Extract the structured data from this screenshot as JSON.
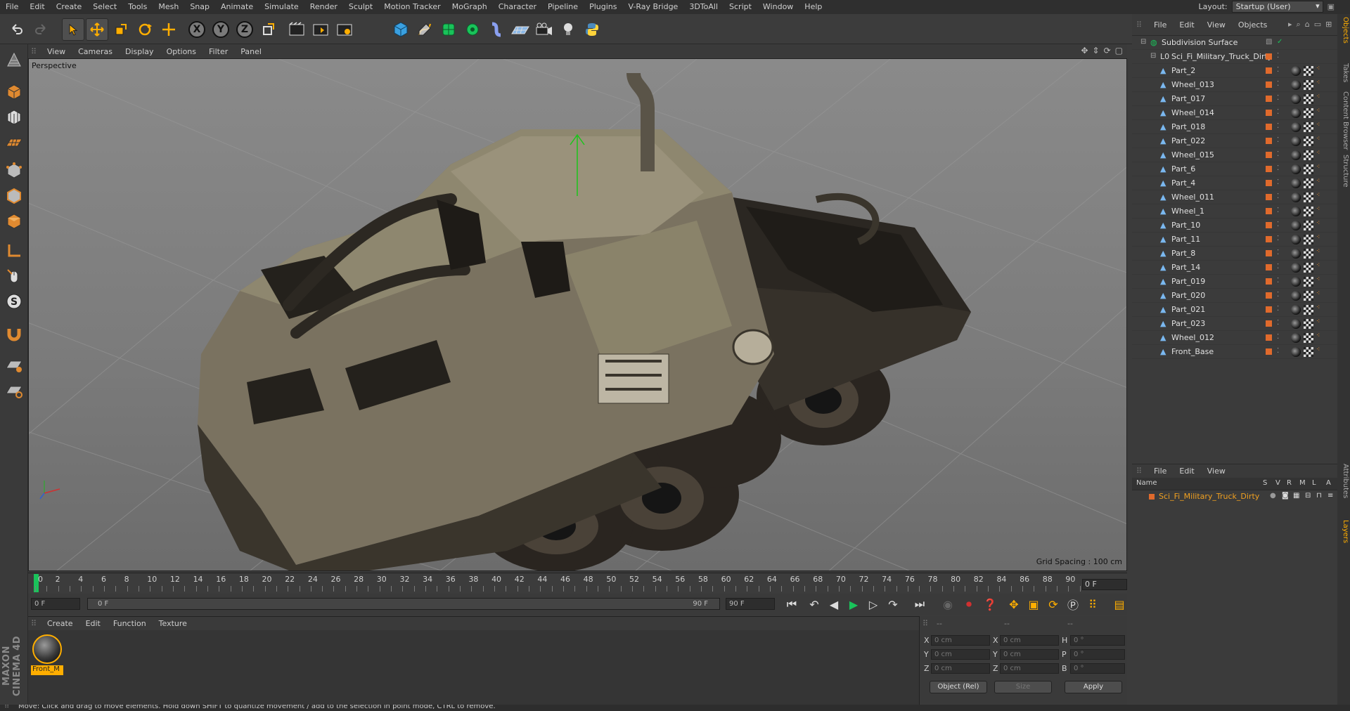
{
  "menu": [
    "File",
    "Edit",
    "Create",
    "Select",
    "Tools",
    "Mesh",
    "Snap",
    "Animate",
    "Simulate",
    "Render",
    "Sculpt",
    "Motion Tracker",
    "MoGraph",
    "Character",
    "Pipeline",
    "Plugins",
    "V-Ray Bridge",
    "3DToAll",
    "Script",
    "Window",
    "Help"
  ],
  "layout": {
    "label": "Layout:",
    "value": "Startup (User)"
  },
  "viewport": {
    "menu": [
      "View",
      "Cameras",
      "Display",
      "Options",
      "Filter",
      "Panel"
    ],
    "label": "Perspective",
    "grid_spacing": "Grid Spacing : 100 cm"
  },
  "timeline": {
    "ticks": [
      "0",
      "2",
      "4",
      "6",
      "8",
      "10",
      "12",
      "14",
      "16",
      "18",
      "20",
      "22",
      "24",
      "26",
      "28",
      "30",
      "32",
      "34",
      "36",
      "38",
      "40",
      "42",
      "44",
      "46",
      "48",
      "50",
      "52",
      "54",
      "56",
      "58",
      "60",
      "62",
      "64",
      "66",
      "68",
      "70",
      "72",
      "74",
      "76",
      "78",
      "80",
      "82",
      "84",
      "86",
      "88",
      "90"
    ],
    "current_frame": "0 F"
  },
  "transport": {
    "start": "0 F",
    "range_start": "0 F",
    "range_end": "90 F",
    "end": "90 F"
  },
  "materials": {
    "menu": [
      "Create",
      "Edit",
      "Function",
      "Texture"
    ],
    "items": [
      {
        "name": "Front_M"
      }
    ]
  },
  "coords": {
    "headers": [
      "--",
      "--",
      "--"
    ],
    "rows": [
      {
        "a": "X",
        "av": "0 cm",
        "b": "X",
        "bv": "0 cm",
        "c": "H",
        "cv": "0 °"
      },
      {
        "a": "Y",
        "av": "0 cm",
        "b": "Y",
        "bv": "0 cm",
        "c": "P",
        "cv": "0 °"
      },
      {
        "a": "Z",
        "av": "0 cm",
        "b": "Z",
        "bv": "0 cm",
        "c": "B",
        "cv": "0 °"
      }
    ],
    "mode": "Object (Rel)",
    "size": "Size",
    "apply": "Apply"
  },
  "objects": {
    "menu": [
      "File",
      "Edit",
      "View",
      "Objects"
    ],
    "root": "Subdivision Surface",
    "group": "Sci_Fi_Military_Truck_Dirty",
    "children": [
      "Part_2",
      "Wheel_013",
      "Part_017",
      "Wheel_014",
      "Part_018",
      "Part_022",
      "Wheel_015",
      "Part_6",
      "Part_4",
      "Wheel_011",
      "Wheel_1",
      "Part_10",
      "Part_11",
      "Part_8",
      "Part_14",
      "Part_019",
      "Part_020",
      "Part_021",
      "Part_023",
      "Wheel_012",
      "Front_Base"
    ]
  },
  "layers": {
    "menu": [
      "File",
      "Edit",
      "View"
    ],
    "columns": [
      "Name",
      "S",
      "V",
      "R",
      "M",
      "L",
      "A"
    ],
    "items": [
      "Sci_Fi_Military_Truck_Dirty"
    ]
  },
  "side_tabs": [
    "Objects",
    "Takes",
    "Content Browser",
    "Structure",
    "Attributes",
    "Layers"
  ],
  "status": "Move: Click and drag to move elements. Hold down SHIFT to quantize movement / add to the selection in point mode, CTRL to remove.",
  "brand": "MAXON CINEMA 4D",
  "colors": {
    "accent": "#ffae00",
    "object_swatch": "#e06a2c",
    "timeline_cursor": "#19c35a",
    "layer_name": "#f0a020"
  }
}
